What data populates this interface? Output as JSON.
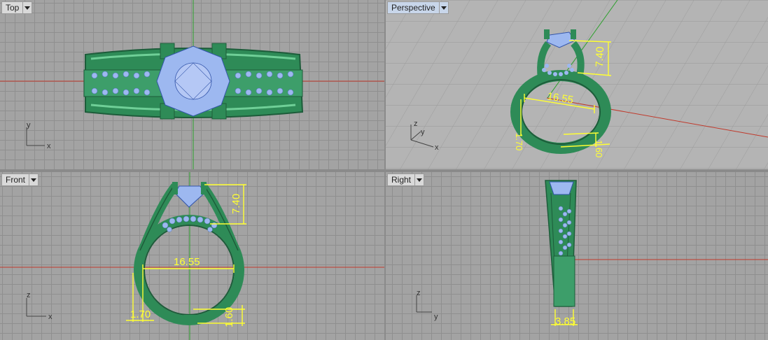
{
  "viewports": {
    "top": {
      "title": "Top",
      "axis_x": "x",
      "axis_y": "y"
    },
    "perspective": {
      "title": "Perspective",
      "axis_x": "x",
      "axis_y": "y",
      "axis_z": "z"
    },
    "front": {
      "title": "Front",
      "axis_x": "x",
      "axis_z": "z"
    },
    "right": {
      "title": "Right",
      "axis_y": "y",
      "axis_z": "z"
    }
  },
  "dimensions": {
    "height": "7.40",
    "inner_diameter": "16.55",
    "band_thickness": "1.70",
    "band_height": "1.60",
    "band_width": "3.85"
  },
  "colors": {
    "ring_green": "#2e8b57",
    "stone_blue": "#9db8f0",
    "dimension_yellow": "#ffff33",
    "x_axis_red": "#c0392b",
    "y_axis_green": "#2ca02c"
  }
}
